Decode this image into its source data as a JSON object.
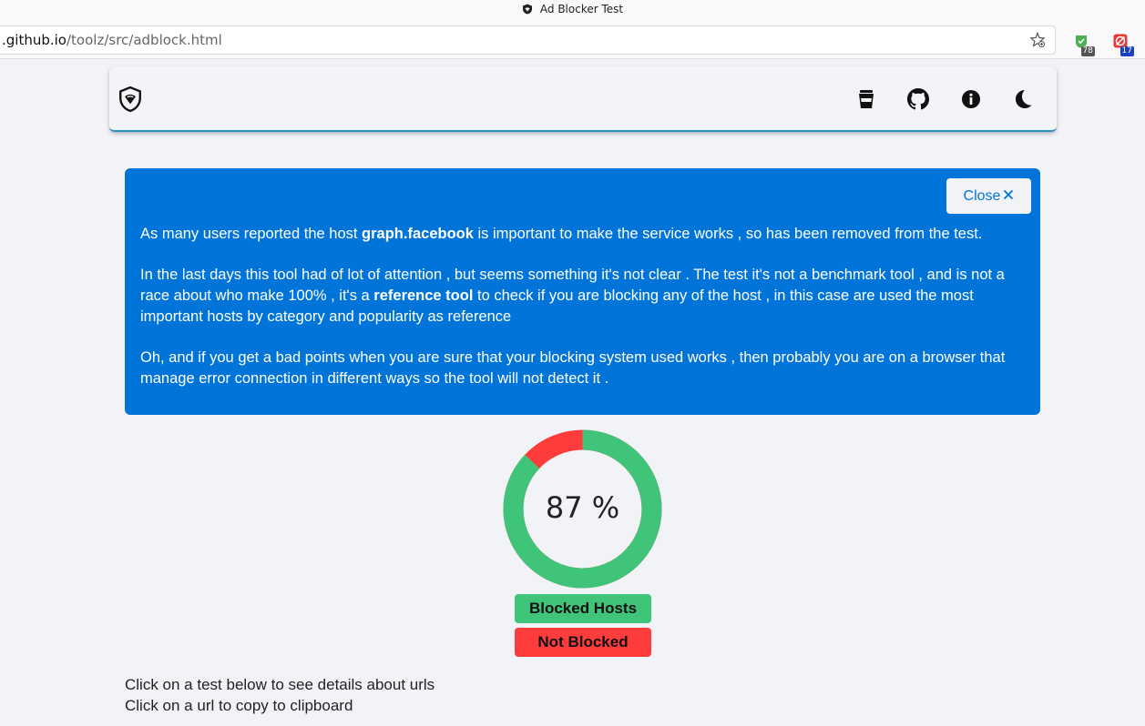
{
  "browser": {
    "tab_title": "Ad Blocker Test",
    "url_host": ".github.io",
    "url_path": "/toolz/src/adblock.html",
    "extensions": [
      {
        "name": "extension-1",
        "badge": "78",
        "badge_color": "#555555"
      },
      {
        "name": "extension-2",
        "badge": "17",
        "badge_color": "#1a3fbf"
      }
    ]
  },
  "navbar": {
    "icons": [
      "shield-logo-icon",
      "coffee-cup-icon",
      "github-icon",
      "info-icon",
      "moon-icon"
    ]
  },
  "alert": {
    "close_label": "Close",
    "p1_pre": "As many users reported the host ",
    "p1_bold": "graph.facebook",
    "p1_post": " is important to make the service works , so has been removed from the test.",
    "p2_pre": "In the last days this tool had of lot of attention , but seems something it's not clear . The test it's not a benchmark tool , and is not a race about who make 100% , it's a ",
    "p2_bold": "reference tool",
    "p2_post": " to check if you are blocking any of the host , in this case are used the most important hosts by category and popularity as reference",
    "p3": "Oh, and if you get a bad points when you are sure that your blocking system used works , then probably you are on a browser that manage error connection in different ways so the tool will not detect it ."
  },
  "result": {
    "score_label": "87 %",
    "blocked_fraction": 0.87,
    "blocked_color": "#3fc47a",
    "not_blocked_color": "#ff3c3c",
    "legend_blocked": "Blocked Hosts",
    "legend_not_blocked": "Not Blocked"
  },
  "hints": {
    "line1": "Click on a test below to see details about urls",
    "line2": "Click on a url to copy to clipboard"
  },
  "colors": {
    "accent": "#0074d9",
    "page_bg": "#f2f3f7"
  }
}
